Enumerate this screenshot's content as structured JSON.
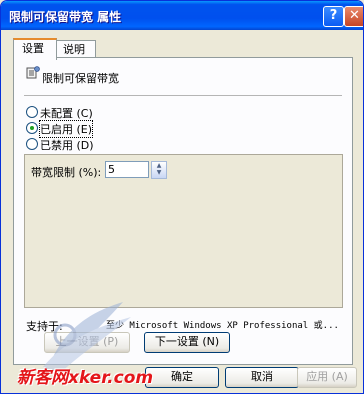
{
  "window": {
    "title": "限制可保留带宽 属性",
    "help_glyph": "?",
    "close_glyph": "✕"
  },
  "tabs": [
    {
      "label": "设置",
      "active": true
    },
    {
      "label": "说明",
      "active": false
    }
  ],
  "policy": {
    "icon": "policy-setting-icon",
    "name": "限制可保留带宽"
  },
  "options": [
    {
      "label": "未配置 (C)",
      "selected": false
    },
    {
      "label": "已启用 (E)",
      "selected": true
    },
    {
      "label": "已禁用 (D)",
      "selected": false
    }
  ],
  "bandwidth": {
    "label": "带宽限制 (%):",
    "value": "5"
  },
  "supported": {
    "label": "支持于:",
    "value": "至少 Microsoft Windows XP Professional 或..."
  },
  "nav_buttons": {
    "prev": "上一设置 (P)",
    "next": "下一设置 (N)"
  },
  "dialog_buttons": {
    "ok": "确定",
    "cancel": "取消",
    "apply": "应用 (A)"
  },
  "watermark": {
    "text": "新客网xker.com"
  }
}
